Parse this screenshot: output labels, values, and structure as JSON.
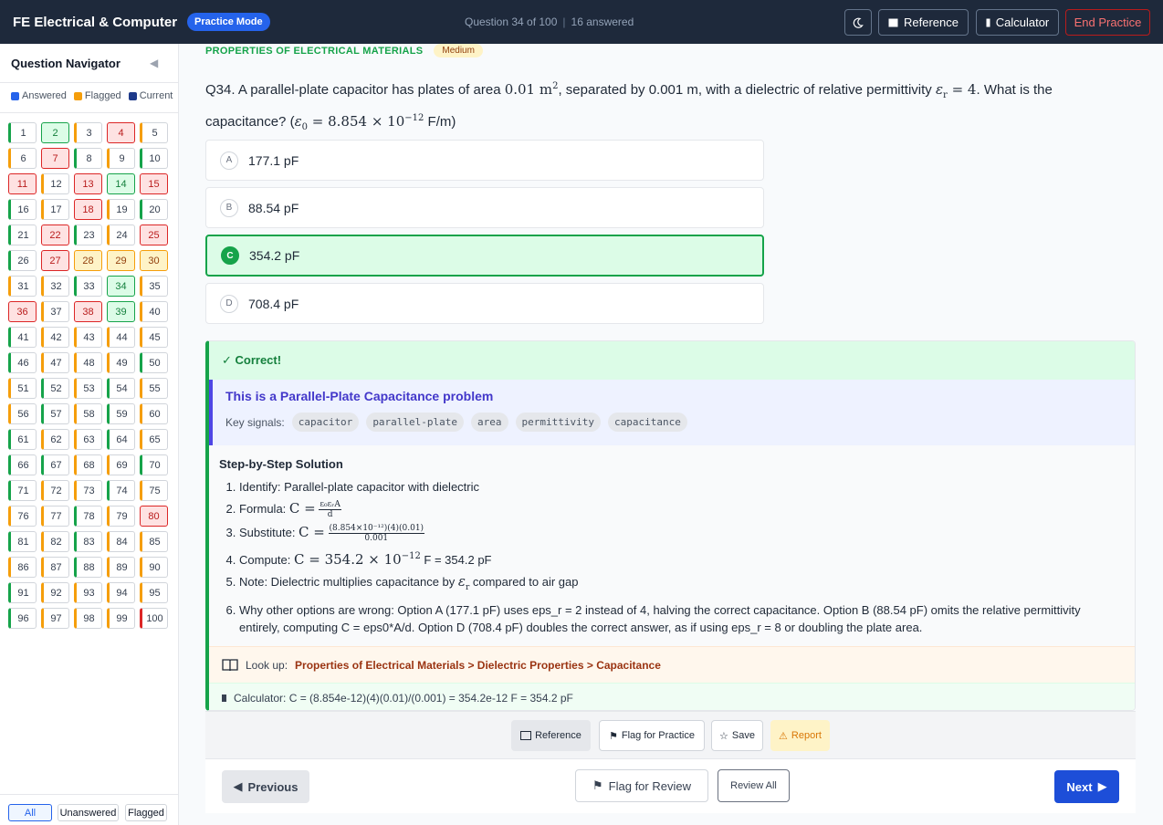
{
  "header": {
    "app_title": "FE Electrical & Computer",
    "mode_badge": "Practice Mode",
    "question_progress": "Question 34 of 100",
    "answered_count": "16 answered",
    "theme_icon": "moon-icon",
    "reference_label": "Reference",
    "calculator_label": "Calculator",
    "end_label": "End Practice"
  },
  "sidebar": {
    "title": "Question Navigator",
    "legend": [
      {
        "label": "Answered",
        "color": "#2563eb"
      },
      {
        "label": "Flagged",
        "color": "#f59e0b"
      },
      {
        "label": "Current",
        "color": "#1e3a8a"
      }
    ],
    "filters": {
      "all": "All",
      "unanswered": "Unanswered",
      "flagged": "Flagged"
    }
  },
  "question": {
    "topic": "PROPERTIES OF ELECTRICAL MATERIALS",
    "difficulty": "Medium",
    "prefix": "Q34. A parallel-plate capacitor has plates of area ",
    "area": "0.01 m",
    "mid": ", separated by 0.001 m, with a dielectric of relative permittivity ",
    "eps_eq": "ε",
    "eps_val": " = 4",
    "tail": ". What is the capacitance? (",
    "eps0_eq": "ε",
    "eps0_val": " = 8.854 × 10",
    "eps0_exp": "−12",
    "unit": " F/m)",
    "options": [
      {
        "letter": "A",
        "text": "177.1 pF"
      },
      {
        "letter": "B",
        "text": "88.54 pF"
      },
      {
        "letter": "C",
        "text": "354.2 pF"
      },
      {
        "letter": "D",
        "text": "708.4 pF"
      }
    ]
  },
  "feedback": {
    "result": "✓ Correct!",
    "problem_title": "This is a Parallel-Plate Capacitance problem",
    "signals_label": "Key signals:",
    "signals": [
      "capacitor",
      "parallel-plate",
      "area",
      "permittivity",
      "capacitance"
    ],
    "steps_title": "Step-by-Step Solution",
    "step1": "Identify: Parallel-plate capacitor with dielectric",
    "step2_label": "Formula: ",
    "step2_lhs": "C =",
    "step2_num": "ε₀εᵣA",
    "step2_den": "d",
    "step3_label": "Substitute: ",
    "step3_lhs": "C =",
    "step3_num": "(8.854×10⁻¹²)(4)(0.01)",
    "step3_den": "0.001",
    "step4_label": "Compute: ",
    "step4_math": "C = 354.2 × 10",
    "step4_exp": "−12",
    "step4_tail": " F = 354.2 pF",
    "step5_pre": "Note: Dielectric multiplies capacitance by ",
    "step5_sym": "ε",
    "step5_post": " compared to air gap",
    "step6": "Why other options are wrong: Option A (177.1 pF) uses eps_r = 2 instead of 4, halving the correct capacitance. Option B (88.54 pF) omits the relative permittivity entirely, computing C = eps0*A/d. Option D (708.4 pF) doubles the correct answer, as if using eps_r = 8 or doubling the plate area.",
    "lookup_label": "Look up:",
    "lookup_path": "Properties of Electrical Materials > Dielectric Properties > Capacitance",
    "calc_text": "Calculator: C = (8.854e-12)(4)(0.01)/(0.001) = 354.2e-12 F = 354.2 pF"
  },
  "actions": {
    "reference": "Reference",
    "flag_practice": "Flag for Practice",
    "save": "Save",
    "report": "Report"
  },
  "nav": {
    "previous": "Previous",
    "flag_review": "Flag for Review",
    "review_all": "Review All",
    "next": "Next"
  },
  "grid_cells": [
    {
      "n": "1",
      "s": "g"
    },
    {
      "n": "2",
      "s": "right"
    },
    {
      "n": "3",
      "s": "o"
    },
    {
      "n": "4",
      "s": "wrong"
    },
    {
      "n": "5",
      "s": "o"
    },
    {
      "n": "6",
      "s": "o"
    },
    {
      "n": "7",
      "s": "wrong"
    },
    {
      "n": "8",
      "s": "g"
    },
    {
      "n": "9",
      "s": "o"
    },
    {
      "n": "10",
      "s": "g"
    },
    {
      "n": "11",
      "s": "wrong"
    },
    {
      "n": "12",
      "s": "o"
    },
    {
      "n": "13",
      "s": "wrong"
    },
    {
      "n": "14",
      "s": "right"
    },
    {
      "n": "15",
      "s": "wrong"
    },
    {
      "n": "16",
      "s": "g"
    },
    {
      "n": "17",
      "s": "o"
    },
    {
      "n": "18",
      "s": "wrong"
    },
    {
      "n": "19",
      "s": "o"
    },
    {
      "n": "20",
      "s": "g"
    },
    {
      "n": "21",
      "s": "g"
    },
    {
      "n": "22",
      "s": "wrong"
    },
    {
      "n": "23",
      "s": "g"
    },
    {
      "n": "24",
      "s": "o"
    },
    {
      "n": "25",
      "s": "wrong"
    },
    {
      "n": "26",
      "s": "g"
    },
    {
      "n": "27",
      "s": "wrong"
    },
    {
      "n": "28",
      "s": "flagged"
    },
    {
      "n": "29",
      "s": "flagged"
    },
    {
      "n": "30",
      "s": "flagged"
    },
    {
      "n": "31",
      "s": "o"
    },
    {
      "n": "32",
      "s": "o"
    },
    {
      "n": "33",
      "s": "g"
    },
    {
      "n": "34",
      "s": "right"
    },
    {
      "n": "35",
      "s": "o"
    },
    {
      "n": "36",
      "s": "wrong"
    },
    {
      "n": "37",
      "s": "o"
    },
    {
      "n": "38",
      "s": "wrong"
    },
    {
      "n": "39",
      "s": "right"
    },
    {
      "n": "40",
      "s": "o"
    },
    {
      "n": "41",
      "s": "g"
    },
    {
      "n": "42",
      "s": "o"
    },
    {
      "n": "43",
      "s": "o"
    },
    {
      "n": "44",
      "s": "o"
    },
    {
      "n": "45",
      "s": "o"
    },
    {
      "n": "46",
      "s": "g"
    },
    {
      "n": "47",
      "s": "o"
    },
    {
      "n": "48",
      "s": "o"
    },
    {
      "n": "49",
      "s": "o"
    },
    {
      "n": "50",
      "s": "g"
    },
    {
      "n": "51",
      "s": "o"
    },
    {
      "n": "52",
      "s": "g"
    },
    {
      "n": "53",
      "s": "o"
    },
    {
      "n": "54",
      "s": "g"
    },
    {
      "n": "55",
      "s": "o"
    },
    {
      "n": "56",
      "s": "o"
    },
    {
      "n": "57",
      "s": "g"
    },
    {
      "n": "58",
      "s": "o"
    },
    {
      "n": "59",
      "s": "g"
    },
    {
      "n": "60",
      "s": "o"
    },
    {
      "n": "61",
      "s": "g"
    },
    {
      "n": "62",
      "s": "o"
    },
    {
      "n": "63",
      "s": "o"
    },
    {
      "n": "64",
      "s": "g"
    },
    {
      "n": "65",
      "s": "o"
    },
    {
      "n": "66",
      "s": "g"
    },
    {
      "n": "67",
      "s": "g"
    },
    {
      "n": "68",
      "s": "o"
    },
    {
      "n": "69",
      "s": "o"
    },
    {
      "n": "70",
      "s": "g"
    },
    {
      "n": "71",
      "s": "g"
    },
    {
      "n": "72",
      "s": "o"
    },
    {
      "n": "73",
      "s": "o"
    },
    {
      "n": "74",
      "s": "g"
    },
    {
      "n": "75",
      "s": "o"
    },
    {
      "n": "76",
      "s": "o"
    },
    {
      "n": "77",
      "s": "o"
    },
    {
      "n": "78",
      "s": "g"
    },
    {
      "n": "79",
      "s": "o"
    },
    {
      "n": "80",
      "s": "wrong"
    },
    {
      "n": "81",
      "s": "g"
    },
    {
      "n": "82",
      "s": "o"
    },
    {
      "n": "83",
      "s": "g"
    },
    {
      "n": "84",
      "s": "o"
    },
    {
      "n": "85",
      "s": "o"
    },
    {
      "n": "86",
      "s": "o"
    },
    {
      "n": "87",
      "s": "o"
    },
    {
      "n": "88",
      "s": "g"
    },
    {
      "n": "89",
      "s": "o"
    },
    {
      "n": "90",
      "s": "o"
    },
    {
      "n": "91",
      "s": "g"
    },
    {
      "n": "92",
      "s": "o"
    },
    {
      "n": "93",
      "s": "o"
    },
    {
      "n": "94",
      "s": "o"
    },
    {
      "n": "95",
      "s": "o"
    },
    {
      "n": "96",
      "s": "g"
    },
    {
      "n": "97",
      "s": "o"
    },
    {
      "n": "98",
      "s": "o"
    },
    {
      "n": "99",
      "s": "o"
    },
    {
      "n": "100",
      "s": "r"
    }
  ]
}
